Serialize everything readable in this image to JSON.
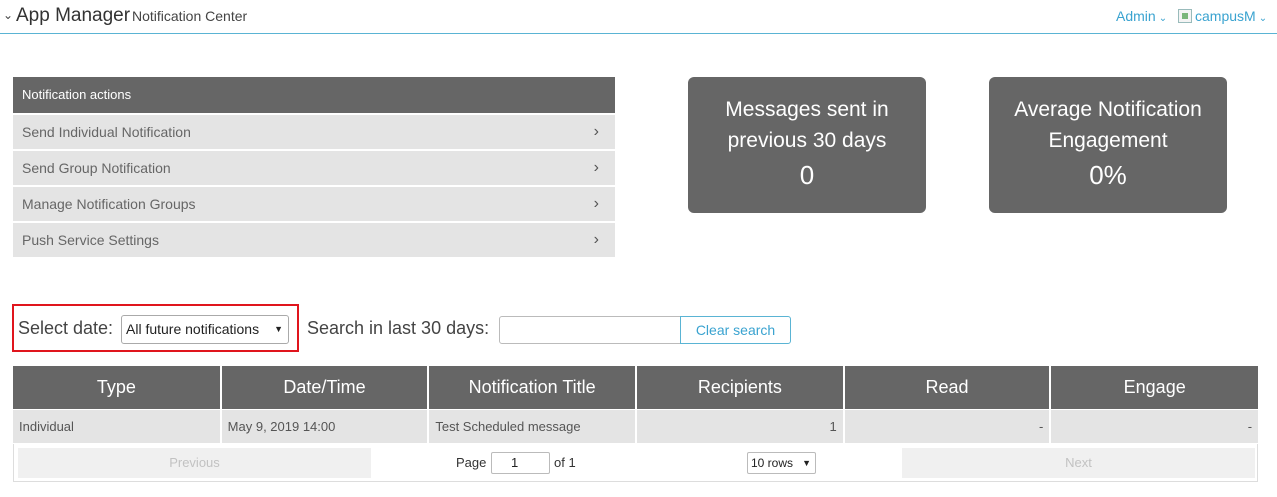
{
  "header": {
    "app_title": "App Manager",
    "subtitle": "Notification Center",
    "admin_label": "Admin",
    "campus_label": "campusM",
    "chevron_icon": "chevron-down-icon",
    "accent_color": "#3aa3d0"
  },
  "actions": {
    "heading": "Notification actions",
    "items": [
      {
        "label": "Send Individual Notification",
        "icon": "chevron-right-icon"
      },
      {
        "label": "Send Group Notification",
        "icon": "chevron-right-icon"
      },
      {
        "label": "Manage Notification Groups",
        "icon": "chevron-right-icon"
      },
      {
        "label": "Push Service Settings",
        "icon": "chevron-right-icon"
      }
    ]
  },
  "stats": [
    {
      "label_line1": "Messages sent in",
      "label_line2": "previous 30 days",
      "value": "0"
    },
    {
      "label_line1": "Average Notification",
      "label_line2": "Engagement",
      "value": "0%"
    }
  ],
  "filters": {
    "select_date_label": "Select date:",
    "select_date_value": "All future notifications",
    "search_label": "Search in last 30 days:",
    "search_value": "",
    "clear_label": "Clear search",
    "highlight_color": "#e0151d"
  },
  "table": {
    "columns": [
      "Type",
      "Date/Time",
      "Notification Title",
      "Recipients",
      "Read",
      "Engage"
    ],
    "rows": [
      {
        "type": "Individual",
        "datetime": "May 9, 2019 14:00",
        "title": "Test Scheduled message",
        "recipients": "1",
        "read": "-",
        "engage": "-"
      }
    ]
  },
  "pager": {
    "prev_label": "Previous",
    "next_label": "Next",
    "page_label": "Page",
    "page_value": "1",
    "of_label": "of 1",
    "rows_value": "10 rows"
  }
}
